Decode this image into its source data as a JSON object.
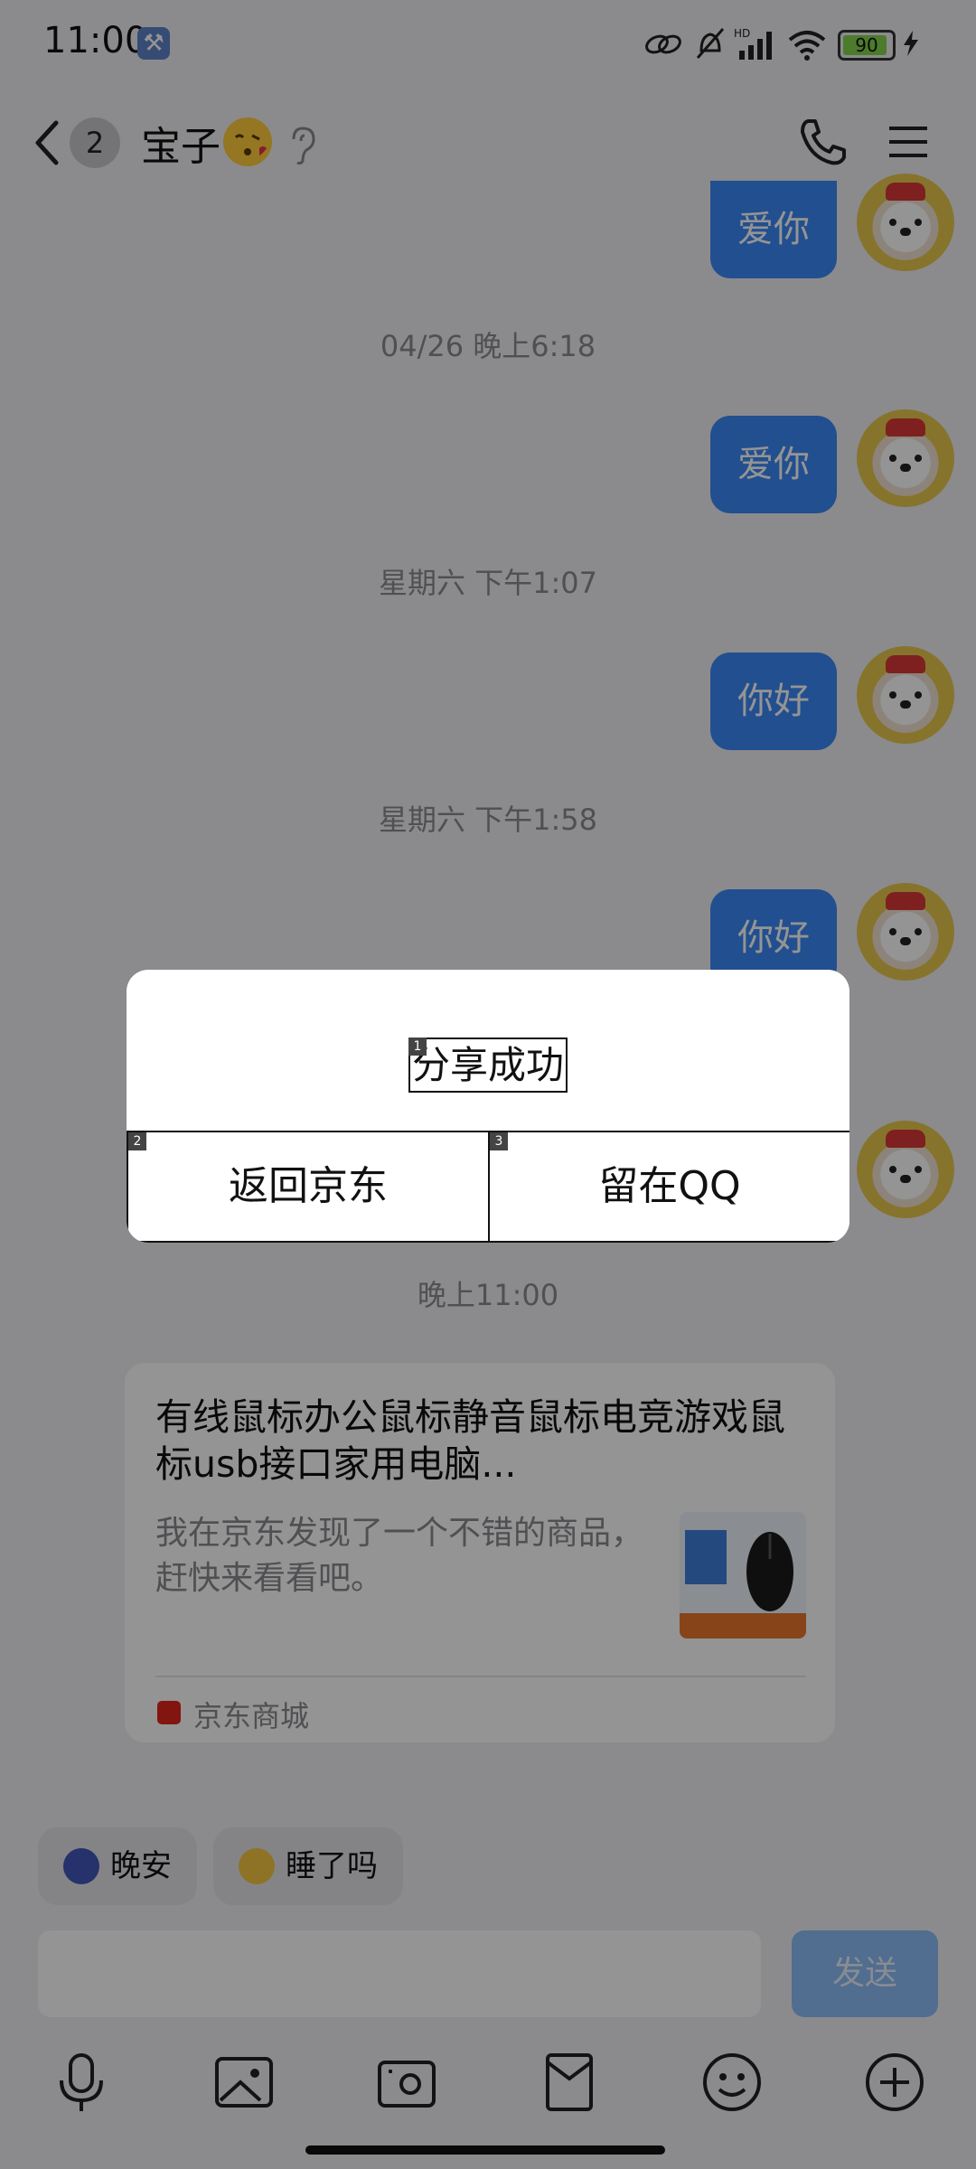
{
  "status_bar": {
    "time": "11:00",
    "battery": "90",
    "network_label": "HD"
  },
  "header": {
    "unread_count": "2",
    "title": "宝子"
  },
  "messages": {
    "bubble_1": "爱你",
    "ts_1": "04/26 晚上6:18",
    "bubble_2": "爱你",
    "ts_2": "星期六 下午1:07",
    "bubble_3": "你好",
    "ts_3": "星期六 下午1:58",
    "bubble_4": "你好",
    "ts_4": "晚上11:00"
  },
  "product_card": {
    "title": "有线鼠标办公鼠标静音鼠标电竞游戏鼠标usb接口家用电脑...",
    "description": "我在京东发现了一个不错的商品，赶快来看看吧。",
    "source": "京东商城"
  },
  "quick_replies": [
    {
      "label": "晚安"
    },
    {
      "label": "睡了吗"
    }
  ],
  "input": {
    "send_label": "发送"
  },
  "dialog": {
    "message": "分享成功",
    "back_label": "返回京东",
    "stay_label": "留在QQ",
    "markers": [
      "1",
      "2",
      "3"
    ]
  },
  "colors": {
    "bubble": "#3b88f7",
    "send_disabled": "#8cbcf7",
    "background": "#f0f0f3"
  }
}
